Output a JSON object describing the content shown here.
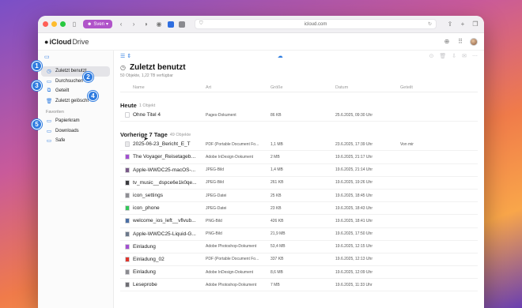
{
  "browser": {
    "profile_label": "Sven",
    "address": "icloud.com",
    "colors": {
      "close": "#ff5f57",
      "minimize": "#febc2e",
      "zoom": "#28c840",
      "profile": "#b054c9"
    }
  },
  "app": {
    "brand_prefix": "iCloud",
    "brand_suffix": "Drive"
  },
  "sidebar": {
    "items": [
      {
        "label": "Zuletzt benutzt",
        "icon": "clock-icon",
        "active": true
      },
      {
        "label": "Durchsuchen",
        "icon": "folder-icon"
      },
      {
        "label": "Geteilt",
        "icon": "shared-folder-icon"
      },
      {
        "label": "Zuletzt gelöscht",
        "icon": "trash-icon"
      }
    ],
    "favorites_heading": "Favoriten",
    "favorites": [
      {
        "label": "Papierkram",
        "icon": "folder-icon"
      },
      {
        "label": "Downloads",
        "icon": "folder-icon"
      },
      {
        "label": "Safe",
        "icon": "folder-icon"
      }
    ]
  },
  "main": {
    "title": "Zuletzt benutzt",
    "subtitle": "50 Objekte, 1,22 TB verfügbar",
    "columns": {
      "name": "Name",
      "kind": "Art",
      "size": "Größe",
      "date": "Datum",
      "shared": "Geteilt"
    },
    "sections": [
      {
        "label": "Heute",
        "count": "1 Objekt",
        "rows": [
          {
            "name": "Ohne Titel 4",
            "kind": "Pages-Dokument",
            "size": "86 KB",
            "date": "25.6.2025, 09:30 Uhr",
            "shared": "",
            "color": "#ffffff"
          }
        ]
      },
      {
        "label": "Vorherige 7 Tage",
        "count": "49 Objekte",
        "rows": [
          {
            "name": "2025-06-23_Bericht_E_T",
            "kind": "PDF (Portable Document Fo...",
            "size": "1,1 MB",
            "date": "23.6.2025, 17:39 Uhr",
            "shared": "Von mir",
            "color": "#e9e9ea"
          },
          {
            "name": "The Voyager_Reisetagebu...",
            "kind": "Adobe InDesign-Dokument",
            "size": "2 MB",
            "date": "19.6.2025, 21:17 Uhr",
            "shared": "",
            "color": "#a34fd1"
          },
          {
            "name": "Apple-WWDC25-macOS-...",
            "kind": "JPEG-Bild",
            "size": "1,4 MB",
            "date": "19.6.2025, 21:14 Uhr",
            "shared": "",
            "color": "#7a5a88"
          },
          {
            "name": "tv_music__dspce6e1k0qe...",
            "kind": "JPEG-Bild",
            "size": "261 KB",
            "date": "19.6.2025, 19:26 Uhr",
            "shared": "",
            "color": "#3a3a3e"
          },
          {
            "name": "icon_settings",
            "kind": "JPEG-Datei",
            "size": "25 KB",
            "date": "19.6.2025, 18:45 Uhr",
            "shared": "",
            "color": "#8e8e93"
          },
          {
            "name": "icon_phone",
            "kind": "JPEG-Datei",
            "size": "23 KB",
            "date": "19.6.2025, 18:43 Uhr",
            "shared": "",
            "color": "#34c759"
          },
          {
            "name": "welcome_ios_left__vflvub...",
            "kind": "PNG-Bild",
            "size": "426 KB",
            "date": "19.6.2025, 18:41 Uhr",
            "shared": "",
            "color": "#4a6fa5"
          },
          {
            "name": "Apple-WWDC25-Liquid-G...",
            "kind": "PNG-Bild",
            "size": "21,9 MB",
            "date": "19.6.2025, 17:50 Uhr",
            "shared": "",
            "color": "#6c7a8c"
          },
          {
            "name": "Einladung",
            "kind": "Adobe Photoshop-Dokument",
            "size": "53,4 MB",
            "date": "19.6.2025, 12:15 Uhr",
            "shared": "",
            "color": "#a34fd1"
          },
          {
            "name": "Einladung_02",
            "kind": "PDF (Portable Document Fo...",
            "size": "337 KB",
            "date": "19.6.2025, 12:13 Uhr",
            "shared": "",
            "color": "#e0352b"
          },
          {
            "name": "Einladung",
            "kind": "Adobe InDesign-Dokument",
            "size": "8,6 MB",
            "date": "19.6.2025, 12:09 Uhr",
            "shared": "",
            "color": "#8b8b90"
          },
          {
            "name": "Leseprobe",
            "kind": "Adobe Photoshop-Dokument",
            "size": "7 MB",
            "date": "19.6.2025, 11:33 Uhr",
            "shared": "",
            "color": "#6e6e73"
          }
        ]
      }
    ]
  },
  "badges": [
    "1",
    "2",
    "3",
    "4",
    "5"
  ]
}
